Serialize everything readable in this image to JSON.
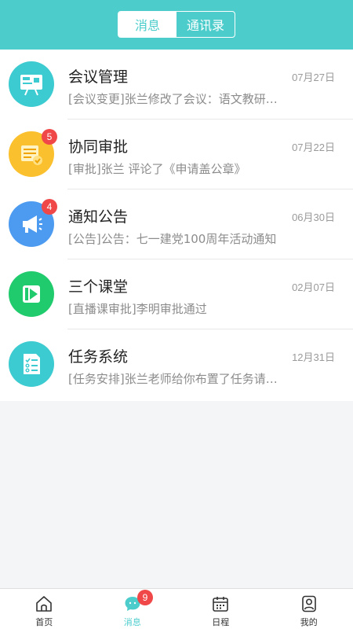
{
  "header": {
    "tabs": [
      {
        "label": "消息",
        "active": true
      },
      {
        "label": "通讯录",
        "active": false
      }
    ]
  },
  "colors": {
    "accent": "#4ccdcc",
    "badge": "#f04848"
  },
  "messages": [
    {
      "title": "会议管理",
      "date": "07月27日",
      "preview": "[会议变更]张兰修改了会议：语文教研会议安排",
      "icon": "presentation-board-icon",
      "color": "#3ccbd0",
      "badge": null
    },
    {
      "title": "协同审批",
      "date": "07月22日",
      "preview": "[审批]张兰 评论了《申请盖公章》",
      "icon": "approval-document-icon",
      "color": "#fbc02d",
      "badge": "5"
    },
    {
      "title": "通知公告",
      "date": "06月30日",
      "preview": "[公告]公告：七一建党100周年活动通知",
      "icon": "megaphone-icon",
      "color": "#4d9bf0",
      "badge": "4"
    },
    {
      "title": "三个课堂",
      "date": "02月07日",
      "preview": "[直播课审批]李明审批通过",
      "icon": "video-play-icon",
      "color": "#1fcb6d",
      "badge": null
    },
    {
      "title": "任务系统",
      "date": "12月31日",
      "preview": "[任务安排]张兰老师给你布置了任务请查看",
      "icon": "task-checklist-icon",
      "color": "#3ccbd0",
      "badge": null
    }
  ],
  "tabbar": {
    "items": [
      {
        "label": "首页",
        "icon": "home-icon",
        "active": false
      },
      {
        "label": "消息",
        "icon": "message-bubble-icon",
        "active": true,
        "badge": "9"
      },
      {
        "label": "日程",
        "icon": "calendar-icon",
        "active": false
      },
      {
        "label": "我的",
        "icon": "user-icon",
        "active": false
      }
    ]
  }
}
